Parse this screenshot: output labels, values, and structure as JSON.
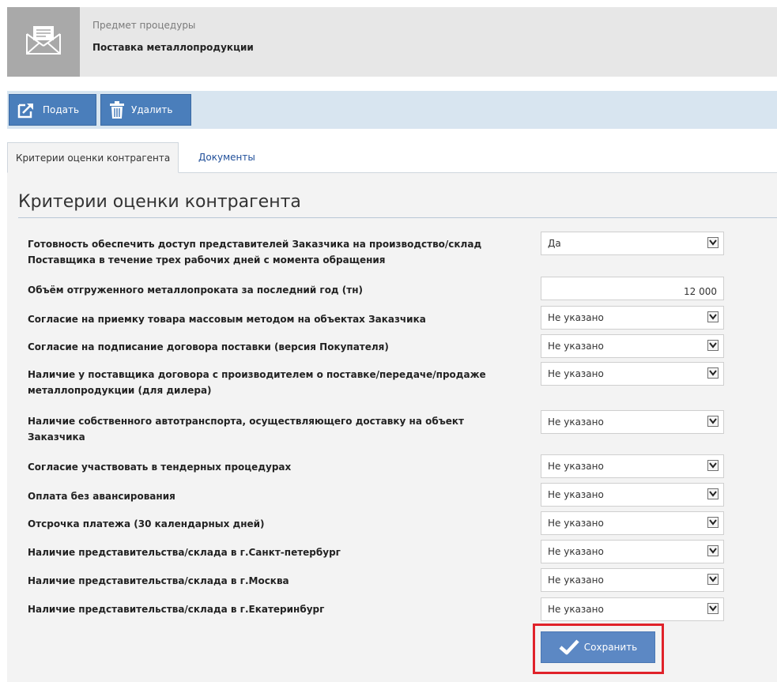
{
  "header": {
    "icon": "envelope-icon",
    "subject_label": "Предмет процедуры",
    "subject_value": "Поставка металлопродукции"
  },
  "toolbar": {
    "submit_label": "Подать",
    "submit_icon": "share-icon",
    "delete_label": "Удалить",
    "delete_icon": "trash-icon"
  },
  "tabs": [
    {
      "label": "Критерии оценки контрагента",
      "active": true
    },
    {
      "label": "Документы",
      "active": false
    }
  ],
  "section": {
    "title": "Критерии оценки контрагента"
  },
  "criteria": [
    {
      "label_lines": [
        "Готовность обеспечить доступ представителей Заказчика на производство/склад",
        "Поставщика в течение трех рабочих дней с момента обращения"
      ],
      "control": "select",
      "value": "Да"
    },
    {
      "label_lines": [
        "Объём отгруженного металлопроката за последний год (тн)"
      ],
      "control": "input",
      "value": "12 000"
    },
    {
      "label_lines": [
        "Согласие на приемку товара массовым методом на объектах Заказчика"
      ],
      "control": "select",
      "value": "Не указано"
    },
    {
      "label_lines": [
        "Согласие на подписание договора поставки (версия Покупателя)"
      ],
      "control": "select",
      "value": "Не указано"
    },
    {
      "label_lines": [
        "Наличие у поставщика договора с производителем о поставке/передаче/продаже",
        "металлопродукции (для дилера)"
      ],
      "control": "select",
      "value": "Не указано"
    },
    {
      "label_lines": [
        "Наличие собственного автотранспорта, осуществляющего доставку на объект",
        "Заказчика"
      ],
      "control": "select",
      "value": "Не указано"
    },
    {
      "label_lines": [
        "Согласие участвовать в тендерных процедурах"
      ],
      "control": "select",
      "value": "Не указано"
    },
    {
      "label_lines": [
        "Оплата без авансирования"
      ],
      "control": "select",
      "value": "Не указано"
    },
    {
      "label_lines": [
        "Отсрочка платежа (30 календарных дней)"
      ],
      "control": "select",
      "value": "Не указано"
    },
    {
      "label_lines": [
        "Наличие представительства/склада в г.Санкт-петербург"
      ],
      "control": "select",
      "value": "Не указано"
    },
    {
      "label_lines": [
        "Наличие представительства/склада в г.Москва"
      ],
      "control": "select",
      "value": "Не указано"
    },
    {
      "label_lines": [
        "Наличие представительства/склада в г.Екатеринбург"
      ],
      "control": "select",
      "value": "Не указано"
    }
  ],
  "save": {
    "label": "Сохранить",
    "icon": "checkmark-icon",
    "highlight_color": "#e0222a"
  },
  "colors": {
    "toolbar_button": "#4a7ebb",
    "save_button": "#5c88c4",
    "tab_link": "#1f4e99"
  }
}
